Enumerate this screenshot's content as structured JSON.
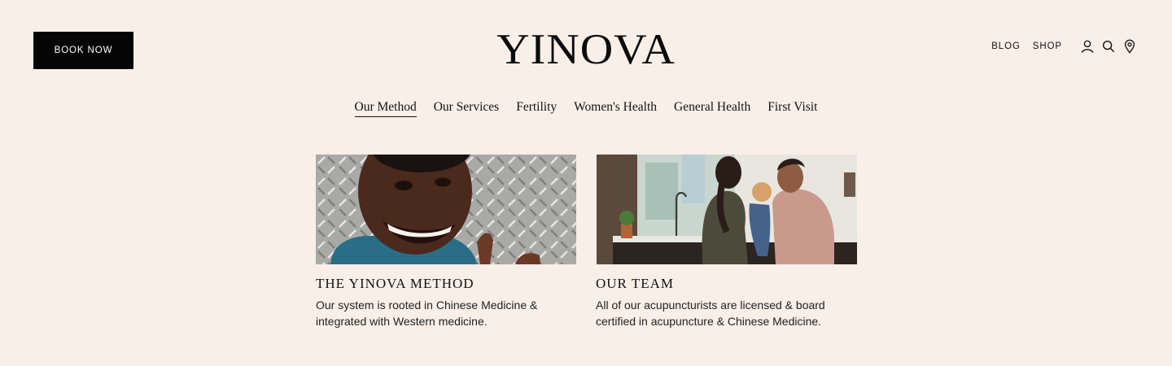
{
  "header": {
    "book_label": "BOOK NOW",
    "logo_text": "YINOVA",
    "blog_label": "BLOG",
    "shop_label": "SHOP",
    "icons": [
      "account-icon",
      "search-icon",
      "location-pin-icon"
    ]
  },
  "nav": {
    "items": [
      "Our Method",
      "Our Services",
      "Fertility",
      "Women's Health",
      "General Health",
      "First Visit"
    ],
    "active_index": 0
  },
  "cards": [
    {
      "title": "THE YINOVA METHOD",
      "description": "Our system is rooted in Chinese Medicine & integrated with Western medicine.",
      "image": "smiling-woman-photo"
    },
    {
      "title": "OUR TEAM",
      "description": "All of our acupuncturists are licensed & board certified in acupuncture & Chinese Medicine.",
      "image": "family-kitchen-photo"
    }
  ],
  "colors": {
    "background": "#f8efe9",
    "button": "#050505",
    "text": "#111111"
  }
}
